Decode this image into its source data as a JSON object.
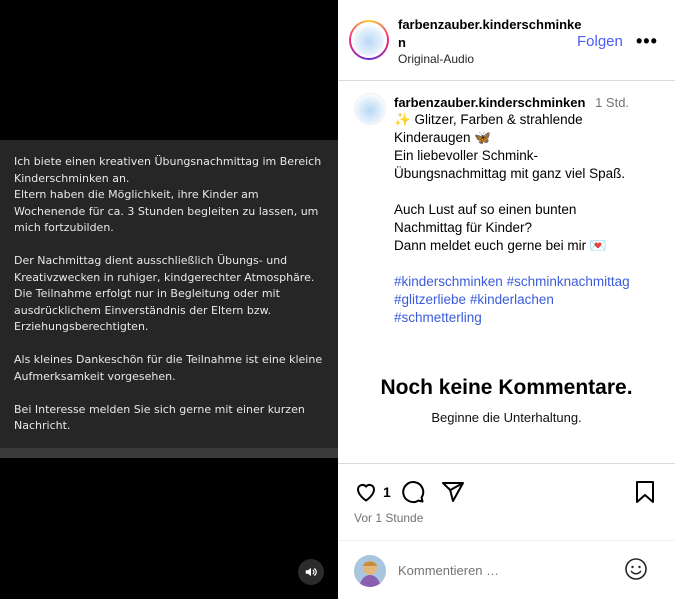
{
  "media": {
    "paragraphs": [
      "Ich biete einen kreativen Übungsnachmittag im Bereich Kinderschminken an.\nEltern haben die Möglichkeit, ihre Kinder am Wochenende für ca. 3 Stunden begleiten zu lassen, um mich fortzubilden.",
      "Der Nachmittag dient ausschließlich Übungs- und Kreativzwecken in ruhiger, kindgerechter Atmosphäre. Die Teilnahme erfolgt nur in Begleitung oder mit ausdrücklichem Einverständnis der Eltern bzw. Erziehungsberechtigten.",
      "Als kleines Dankeschön für die Teilnahme ist eine kleine Aufmerksamkeit vorgesehen.",
      "Bei Interesse melden Sie sich gerne mit einer kurzen Nachricht."
    ],
    "audio_icon": "speaker-icon"
  },
  "header": {
    "username": "farbenzauber.kinderschminken",
    "subtitle": "Original-Audio",
    "follow_label": "Folgen",
    "more_label": "•••"
  },
  "post": {
    "username": "farbenzauber.kinderschminken",
    "time": "1 Std.",
    "lines": [
      "✨ Glitzer, Farben & strahlende",
      "Kinderaugen 🦋",
      "Ein liebevoller Schmink-",
      "Übungsnachmittag mit ganz viel Spaß.",
      "",
      "Auch Lust auf so einen bunten",
      "Nachmittag für Kinder?",
      "Dann meldet euch gerne bei mir 💌"
    ],
    "hashtags": {
      "tag1": "#kinderschminken",
      "tag2": "#schminknachmittag",
      "tag3": "#glitzerliebe",
      "tag4": "#kinderlachen",
      "tag5": "#schmetterling"
    }
  },
  "comments": {
    "empty_title": "Noch keine Kommentare.",
    "empty_subtitle": "Beginne die Unterhaltung."
  },
  "actions": {
    "like_count": "1",
    "time_ago": "Vor 1 Stunde",
    "comment_placeholder": "Kommentieren …",
    "icons": [
      "heart-icon",
      "comment-icon",
      "share-icon",
      "bookmark-icon",
      "emoji-icon"
    ]
  },
  "colors": {
    "accent": "#4a5df9",
    "hashtag": "#3b5bdb",
    "media_card_bg": "#262626"
  }
}
